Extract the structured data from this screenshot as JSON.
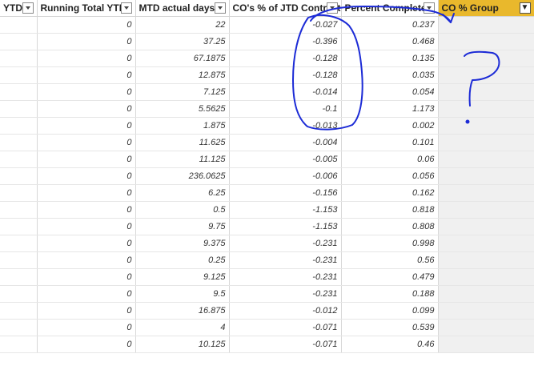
{
  "columns": [
    {
      "label": "YTD"
    },
    {
      "label": "Running Total YTD"
    },
    {
      "label": "MTD actual days"
    },
    {
      "label": "CO's % of JTD Contract"
    },
    {
      "label": "Percent Complete"
    },
    {
      "label": "CO % Group"
    }
  ],
  "rows": [
    {
      "c1": "0",
      "c2": "22",
      "c3": "-0.027",
      "c4": "0.237"
    },
    {
      "c1": "0",
      "c2": "37.25",
      "c3": "-0.396",
      "c4": "0.468"
    },
    {
      "c1": "0",
      "c2": "67.1875",
      "c3": "-0.128",
      "c4": "0.135"
    },
    {
      "c1": "0",
      "c2": "12.875",
      "c3": "-0.128",
      "c4": "0.035"
    },
    {
      "c1": "0",
      "c2": "7.125",
      "c3": "-0.014",
      "c4": "0.054"
    },
    {
      "c1": "0",
      "c2": "5.5625",
      "c3": "-0.1",
      "c4": "1.173"
    },
    {
      "c1": "0",
      "c2": "1.875",
      "c3": "-0.013",
      "c4": "0.002"
    },
    {
      "c1": "0",
      "c2": "11.625",
      "c3": "-0.004",
      "c4": "0.101"
    },
    {
      "c1": "0",
      "c2": "11.125",
      "c3": "-0.005",
      "c4": "0.06"
    },
    {
      "c1": "0",
      "c2": "236.0625",
      "c3": "-0.006",
      "c4": "0.056"
    },
    {
      "c1": "0",
      "c2": "6.25",
      "c3": "-0.156",
      "c4": "0.162"
    },
    {
      "c1": "0",
      "c2": "0.5",
      "c3": "-1.153",
      "c4": "0.818"
    },
    {
      "c1": "0",
      "c2": "9.75",
      "c3": "-1.153",
      "c4": "0.808"
    },
    {
      "c1": "0",
      "c2": "9.375",
      "c3": "-0.231",
      "c4": "0.998"
    },
    {
      "c1": "0",
      "c2": "0.25",
      "c3": "-0.231",
      "c4": "0.56"
    },
    {
      "c1": "0",
      "c2": "9.125",
      "c3": "-0.231",
      "c4": "0.479"
    },
    {
      "c1": "0",
      "c2": "9.5",
      "c3": "-0.231",
      "c4": "0.188"
    },
    {
      "c1": "0",
      "c2": "16.875",
      "c3": "-0.012",
      "c4": "0.099"
    },
    {
      "c1": "0",
      "c2": "4",
      "c3": "-0.071",
      "c4": "0.539"
    },
    {
      "c1": "0",
      "c2": "10.125",
      "c3": "-0.071",
      "c4": "0.46"
    }
  ],
  "icons": {
    "dropdown": "chevron-down-icon",
    "filter": "filter-icon"
  },
  "colors": {
    "active_header": "#e9b82c",
    "annotation_ink": "#1c2bd6",
    "empty_column": "#f0f0f0"
  }
}
